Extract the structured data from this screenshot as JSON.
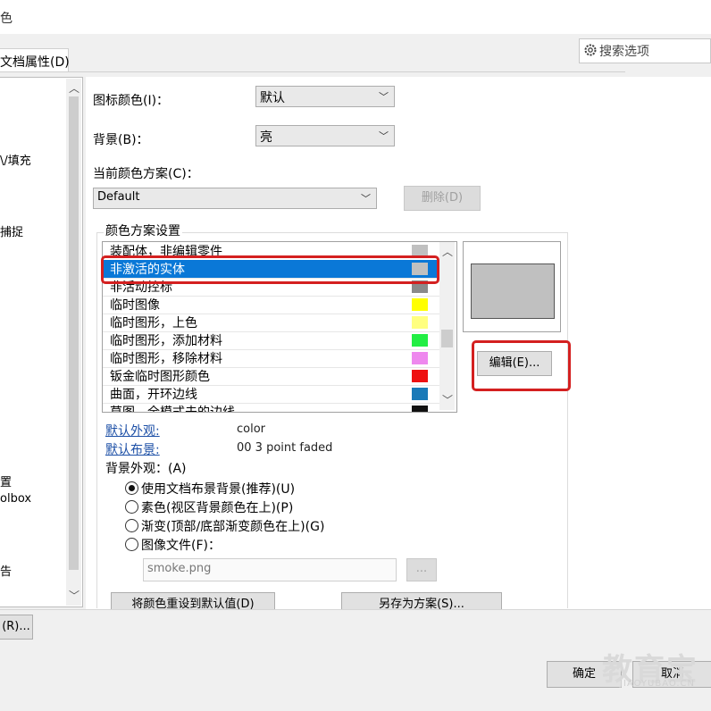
{
  "window": {
    "title_fragment": "色"
  },
  "tab": {
    "label": "文档属性(D)"
  },
  "search": {
    "placeholder": "搜索选项"
  },
  "left_panel": {
    "items": [
      "\\/填充",
      "捕捉",
      "置",
      "olbox",
      "告"
    ],
    "bottom_button": "(R)..."
  },
  "form": {
    "icon_color_label": "图标颜色(I)：",
    "icon_color_value": "默认",
    "background_label": "背景(B)：",
    "background_value": "亮",
    "scheme_label": "当前颜色方案(C)：",
    "scheme_value": "Default",
    "delete_button": "删除(D)",
    "group_title": "颜色方案设置"
  },
  "color_list": [
    {
      "label": "装配体，非编辑零件",
      "swatch": "#c0c0c0"
    },
    {
      "label": "非激活的实体",
      "swatch": "#c0c0c0",
      "selected": true
    },
    {
      "label": "非活动控标",
      "swatch": "#8a8a8a"
    },
    {
      "label": "临时图像",
      "swatch": "#ffff00"
    },
    {
      "label": "临时图形，上色",
      "swatch": "#ffff80"
    },
    {
      "label": "临时图形，添加材料",
      "swatch": "#22ee44"
    },
    {
      "label": "临时图形，移除材料",
      "swatch": "#ee88ee"
    },
    {
      "label": "钣金临时图形颜色",
      "swatch": "#ee1111"
    },
    {
      "label": "曲面，开环边线",
      "swatch": "#1a7ab8"
    },
    {
      "label": "草图，全模式未的边线",
      "swatch": "#111111"
    }
  ],
  "edit_button": "编辑(E)...",
  "appearance": {
    "default_appearance_label": "默认外观:",
    "default_appearance_value": "color",
    "default_scene_label": "默认布景:",
    "default_scene_value": "00 3 point faded",
    "bg_appearance_label": "背景外观：(A)",
    "options": [
      {
        "label": "使用文档布景背景(推荐)(U)",
        "checked": true
      },
      {
        "label": "素色(视区背景颜色在上)(P)",
        "checked": false
      },
      {
        "label": "渐变(顶部/底部渐变颜色在上)(G)",
        "checked": false
      },
      {
        "label": "图像文件(F)：",
        "checked": false
      }
    ],
    "image_file_value": "smoke.png",
    "browse_button": "..."
  },
  "bottom_buttons": {
    "reset": "将颜色重设到默认值(D)",
    "save_as": "另存为方案(S)...",
    "ok": "确定",
    "cancel": "取消"
  },
  "watermark": {
    "main": "教育宝",
    "sub": "JIAOYUBAO.CN"
  }
}
